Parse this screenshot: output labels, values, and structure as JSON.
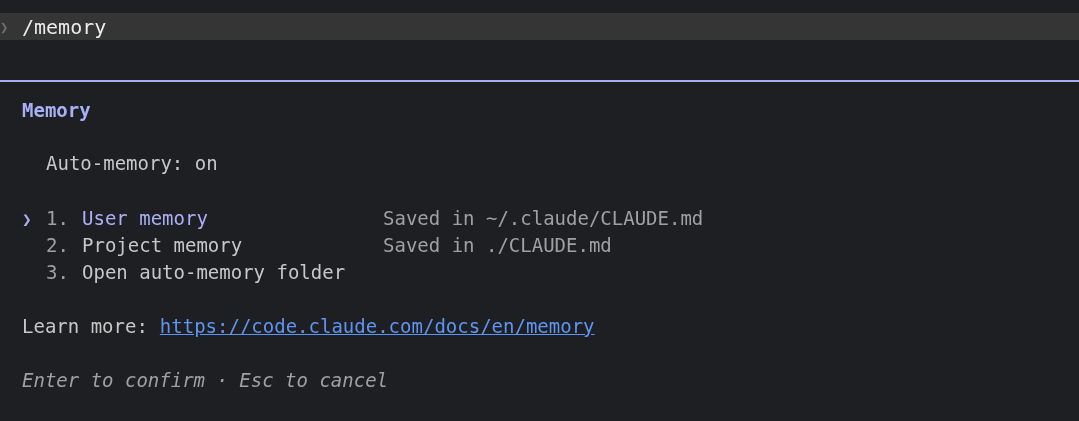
{
  "prompt": {
    "symbol": "❯",
    "command": "/memory"
  },
  "dialog": {
    "title": "Memory",
    "status": "Auto-memory: on",
    "options": [
      {
        "number": "1.",
        "label": "User memory",
        "detail": "Saved in ~/.claude/CLAUDE.md",
        "selected": true
      },
      {
        "number": "2.",
        "label": "Project memory",
        "detail": "Saved in ./CLAUDE.md",
        "selected": false
      },
      {
        "number": "3.",
        "label": "Open auto-memory folder",
        "selected": false
      }
    ],
    "pointer": "❯",
    "learn_more": {
      "label": "Learn more:",
      "link": "https://code.claude.com/docs/en/memory"
    },
    "hint": "Enter to confirm · Esc to cancel"
  }
}
